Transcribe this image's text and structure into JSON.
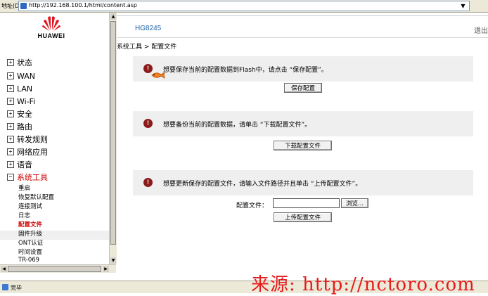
{
  "address_bar": {
    "label": "地址(D)",
    "url": "http://192.168.100.1/html/content.asp"
  },
  "logo": {
    "text": "HUAWEI"
  },
  "header": {
    "device_name": "HG8245",
    "logout": "退出"
  },
  "sidebar": {
    "items": [
      {
        "label": "状态",
        "expander": "+"
      },
      {
        "label": "WAN",
        "expander": "+"
      },
      {
        "label": "LAN",
        "expander": "+"
      },
      {
        "label": "Wi-Fi",
        "expander": "+"
      },
      {
        "label": "安全",
        "expander": "+"
      },
      {
        "label": "路由",
        "expander": "+"
      },
      {
        "label": "转发规则",
        "expander": "+"
      },
      {
        "label": "网络应用",
        "expander": "+"
      },
      {
        "label": "语音",
        "expander": "+"
      },
      {
        "label": "系统工具",
        "expander": "−"
      }
    ],
    "sub_items": [
      {
        "label": "重启"
      },
      {
        "label": "恢复默认配置"
      },
      {
        "label": "连接测试"
      },
      {
        "label": "日志"
      },
      {
        "label": "配置文件"
      },
      {
        "label": "固件升级"
      },
      {
        "label": "ONT认证"
      },
      {
        "label": "时间设置"
      },
      {
        "label": "TR-069"
      }
    ]
  },
  "breadcrumb": "系统工具 > 配置文件",
  "content": {
    "save": {
      "message": "想要保存当前的配置数据到Flash中，请点击 “保存配置”。",
      "button": "保存配置"
    },
    "download": {
      "message": "想要备份当前的配置数据，请单击 “下载配置文件”。",
      "button": "下载配置文件"
    },
    "upload": {
      "message": "想要更新保存的配置文件，请输入文件路径并且单击 “上传配置文件”。",
      "file_label": "配置文件：",
      "file_value": "",
      "browse_button": "浏览...",
      "button": "上传配置文件"
    },
    "warn_glyph": "!"
  },
  "status_bar": {
    "text": "完毕"
  },
  "watermark": "来源: http://nctoro.com",
  "colors": {
    "accent_red": "#cc0000",
    "warn_icon": "#8b1a1a",
    "device_blue": "#1a5fa8",
    "watermark": "#e81a1a"
  }
}
